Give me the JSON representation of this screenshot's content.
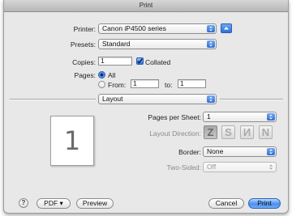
{
  "window": {
    "title": "Print"
  },
  "printer": {
    "label": "Printer:",
    "value": "Canon iP4500 series"
  },
  "presets": {
    "label": "Presets:",
    "value": "Standard"
  },
  "copies": {
    "label": "Copies:",
    "value": "1",
    "collated_label": "Collated"
  },
  "pages": {
    "label": "Pages:",
    "all_label": "All",
    "from_label": "From:",
    "from_value": "1",
    "to_label": "to:",
    "to_value": "1"
  },
  "panel": {
    "value": "Layout"
  },
  "layout": {
    "pages_per_sheet_label": "Pages per Sheet:",
    "pages_per_sheet_value": "1",
    "layout_direction_label": "Layout Direction:",
    "border_label": "Border:",
    "border_value": "None",
    "two_sided_label": "Two-Sided:",
    "two_sided_value": "Off"
  },
  "preview": {
    "page_number": "1"
  },
  "footer": {
    "help": "?",
    "pdf_label": "PDF ▾",
    "preview_label": "Preview",
    "cancel_label": "Cancel",
    "print_label": "Print"
  },
  "colors": {
    "accent": "#3a7de0",
    "sheet_bg": "#e8e8e8"
  }
}
